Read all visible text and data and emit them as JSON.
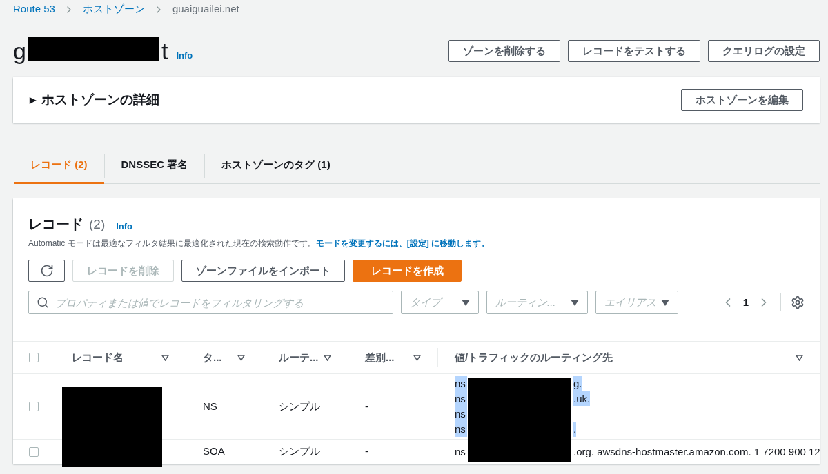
{
  "breadcrumb": [
    {
      "label": "Route 53",
      "link": true
    },
    {
      "label": "ホストゾーン",
      "link": true
    },
    {
      "label": "guaiguailei.net",
      "link": false
    }
  ],
  "header": {
    "title_start": "g",
    "title_end": "t",
    "info": "Info",
    "buttons": [
      "ゾーンを削除する",
      "レコードをテストする",
      "クエリログの設定"
    ]
  },
  "details": {
    "toggle": "▶",
    "title": "ホストゾーンの詳細",
    "expanded": false,
    "button": "ホストゾーンを編集"
  },
  "tabs": [
    {
      "label": "レコード (2)",
      "selected": true
    },
    {
      "label": "DNSSEC 署名",
      "selected": false
    },
    {
      "label": "ホストゾーンのタグ (1)",
      "selected": false
    }
  ],
  "records": {
    "title": "レコード",
    "count": "(2)",
    "info": "Info",
    "description": "Automatic モードは最適なフィルタ結果に最適化された現在の検索動作です。",
    "description_link": "モードを変更するには、[設定] に移動します。",
    "actions": [
      {
        "label": "レコードを削除",
        "kind": "plain",
        "disabled": true
      },
      {
        "label": "ゾーンファイルをインポート",
        "kind": "plain",
        "disabled": false
      },
      {
        "label": "レコードを作成",
        "kind": "primary",
        "disabled": false
      }
    ],
    "search": {
      "placeholder": "プロパティまたは値でレコードをフィルタリングする"
    },
    "filters": [
      {
        "placeholder": "タイプ"
      },
      {
        "placeholder": "ルーティン..."
      },
      {
        "placeholder": "エイリアス"
      }
    ],
    "page": "1",
    "select_all": {
      "checked": false
    },
    "columns": [
      "レコード名",
      "タ...",
      "ルーテ...",
      "差別...",
      "値/トラフィックのルーティング先"
    ],
    "rows": [
      {
        "checked": false,
        "type": "NS",
        "routing": "シンプル",
        "diff": "-",
        "highlighted": true,
        "value_lines": [
          {
            "start": "ns",
            "end": "g."
          },
          {
            "start": "ns",
            "end": ".uk."
          },
          {
            "start": "ns"
          },
          {
            "start": "ns",
            "end": "."
          }
        ]
      },
      {
        "checked": false,
        "type": "SOA",
        "routing": "シンプル",
        "diff": "-",
        "highlighted": false,
        "value_lines": [
          {
            "start": "ns",
            "end": ".org. awsdns-hostmaster.amazon.com. 1 7200 900 12"
          }
        ]
      }
    ]
  }
}
